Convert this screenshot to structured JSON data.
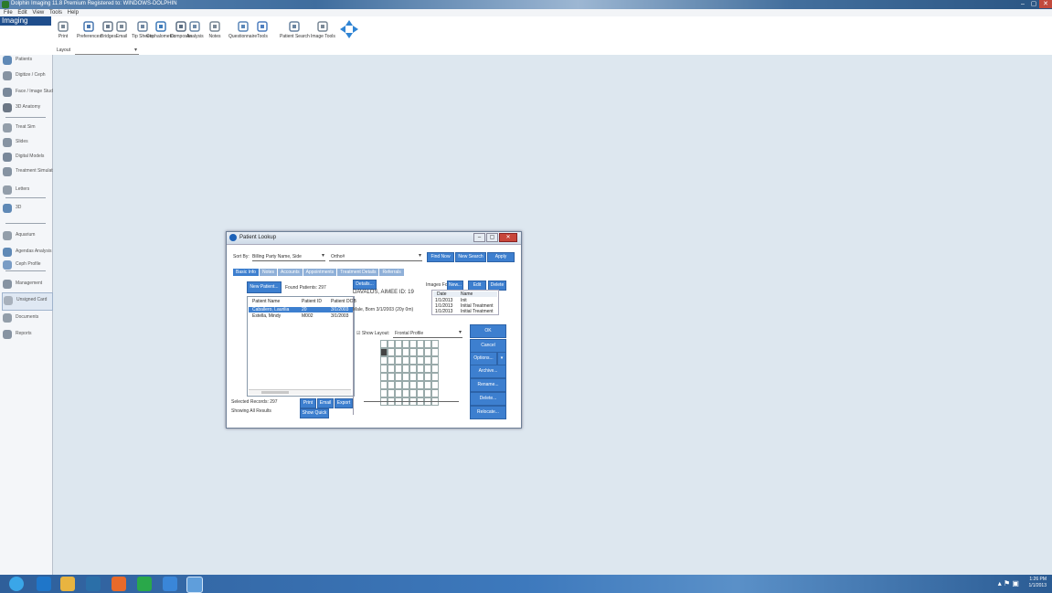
{
  "window": {
    "title": "Dolphin Imaging 11.8 Premium Registered to: WINDOWS-DOLPHIN",
    "min_label": "–",
    "max_label": "▢",
    "close_label": "✕"
  },
  "menu": [
    "File",
    "Edit",
    "View",
    "Tools",
    "Help"
  ],
  "app_name": "Imaging",
  "toolbar": {
    "tools": [
      {
        "label": "Print",
        "icon": "printer-icon"
      },
      {
        "label": "Preferences",
        "icon": "gear-icon"
      },
      {
        "label": "Bridges",
        "icon": "bridge-icon"
      },
      {
        "label": "Email",
        "icon": "email-icon"
      },
      {
        "label": "Tip Sheets",
        "icon": "document-icon"
      },
      {
        "label": "Cephalometric",
        "icon": "ceph-icon"
      },
      {
        "label": "Composite",
        "icon": "grid-icon"
      },
      {
        "label": "Analysis",
        "icon": "analysis-icon"
      },
      {
        "label": "Notes",
        "icon": "notes-icon"
      },
      {
        "label": "Questionnaire",
        "icon": "questionnaire-icon"
      },
      {
        "label": "Tools",
        "icon": "tools-icon"
      },
      {
        "label": "Patient Search",
        "icon": "magnifier-icon"
      },
      {
        "label": "Image Tools",
        "icon": "wrench-icon"
      },
      {
        "label": "Navigate",
        "icon": "navigate-arrows-icon"
      }
    ],
    "layout_label": "Layout"
  },
  "sidebar": {
    "items": [
      {
        "label": "Patients",
        "icon": "patient-icon"
      },
      {
        "label": "Digitize / Ceph",
        "icon": "ceph-icon"
      },
      {
        "label": "Face / Image Studio",
        "icon": "face-icon"
      },
      {
        "label": "3D Anatomy",
        "icon": "anatomy-icon"
      },
      {
        "label": "Treat Sim",
        "icon": "treat-icon"
      },
      {
        "label": "Slides",
        "icon": "slides-icon"
      },
      {
        "label": "Digital Models",
        "icon": "models-icon"
      },
      {
        "label": "Treatment Simulation",
        "icon": "simulation-icon"
      },
      {
        "label": "Letters",
        "icon": "letters-icon"
      },
      {
        "label": "3D",
        "icon": "3d-icon"
      },
      {
        "label": "Aquarium",
        "icon": "aquarium-icon"
      },
      {
        "label": "Agendas Analysis",
        "icon": "agenda-icon"
      },
      {
        "label": "Ceph Profile",
        "icon": "ceph-profile-icon"
      },
      {
        "label": "Management",
        "icon": "management-icon"
      },
      {
        "label": "Unsigned Card",
        "icon": "card-icon"
      },
      {
        "label": "Documents",
        "icon": "documents-icon"
      },
      {
        "label": "Reports",
        "icon": "reports-icon"
      }
    ]
  },
  "dialog": {
    "title": "Patient Lookup",
    "sort_label": "Sort By:",
    "sort_value": "Billing Party Name, Side",
    "filter_value": "Ortho#",
    "find_now": "Find Now",
    "new_search": "New Search",
    "apply": "Apply",
    "tabs": [
      "Basic Info",
      "Notes",
      "Accounts",
      "Appointments",
      "Treatment Details",
      "Referrals"
    ],
    "new_patient": "New Patient...",
    "found_label": "Found Patients: 297",
    "columns": [
      "Patient Name",
      "Patient ID",
      "Patient DOB"
    ],
    "rows": [
      [
        "Caballero, Laurilia",
        "20",
        "3/1/2003"
      ],
      [
        "Estella, Mindy",
        "M002",
        "3/1/2003"
      ]
    ],
    "details_btn": "Details...",
    "patient_name": "DAVALOS, AIMEE  ID: 19",
    "patient_info": "Male, Born 3/1/2003 (20y 0m)",
    "images_label": "Images For:",
    "images_new": "New...",
    "images_edit": "Edit",
    "images_delete": "Delete",
    "img_cols": [
      "Date",
      "Name"
    ],
    "img_rows": [
      [
        "1/1/2013",
        "Init"
      ],
      [
        "1/1/2013",
        "Initial Treatment"
      ],
      [
        "1/1/2013",
        "Initial Treatment"
      ]
    ],
    "show_layout": "Show Layout:",
    "layout_value": "Frontal Profile",
    "ok": "OK",
    "cancel": "Cancel",
    "options": "Options...",
    "archive": "Archive...",
    "rename": "Rename...",
    "delete": "Delete...",
    "relocate": "Relocate...",
    "selected_count": "Selected Records: 297",
    "showing": "Showing All Results",
    "btn_print": "Print",
    "btn_email": "Email",
    "btn_export": "Export",
    "btn_showall": "Show Quick"
  },
  "taskbar": {
    "apps": [
      "start-orb-icon",
      "internet-explorer-icon",
      "file-explorer-icon",
      "media-player-icon",
      "firefox-icon",
      "chrome-icon",
      "dolphin-icon",
      "dolphin-active-icon"
    ],
    "time": "1:26 PM",
    "date": "1/1/2013"
  }
}
